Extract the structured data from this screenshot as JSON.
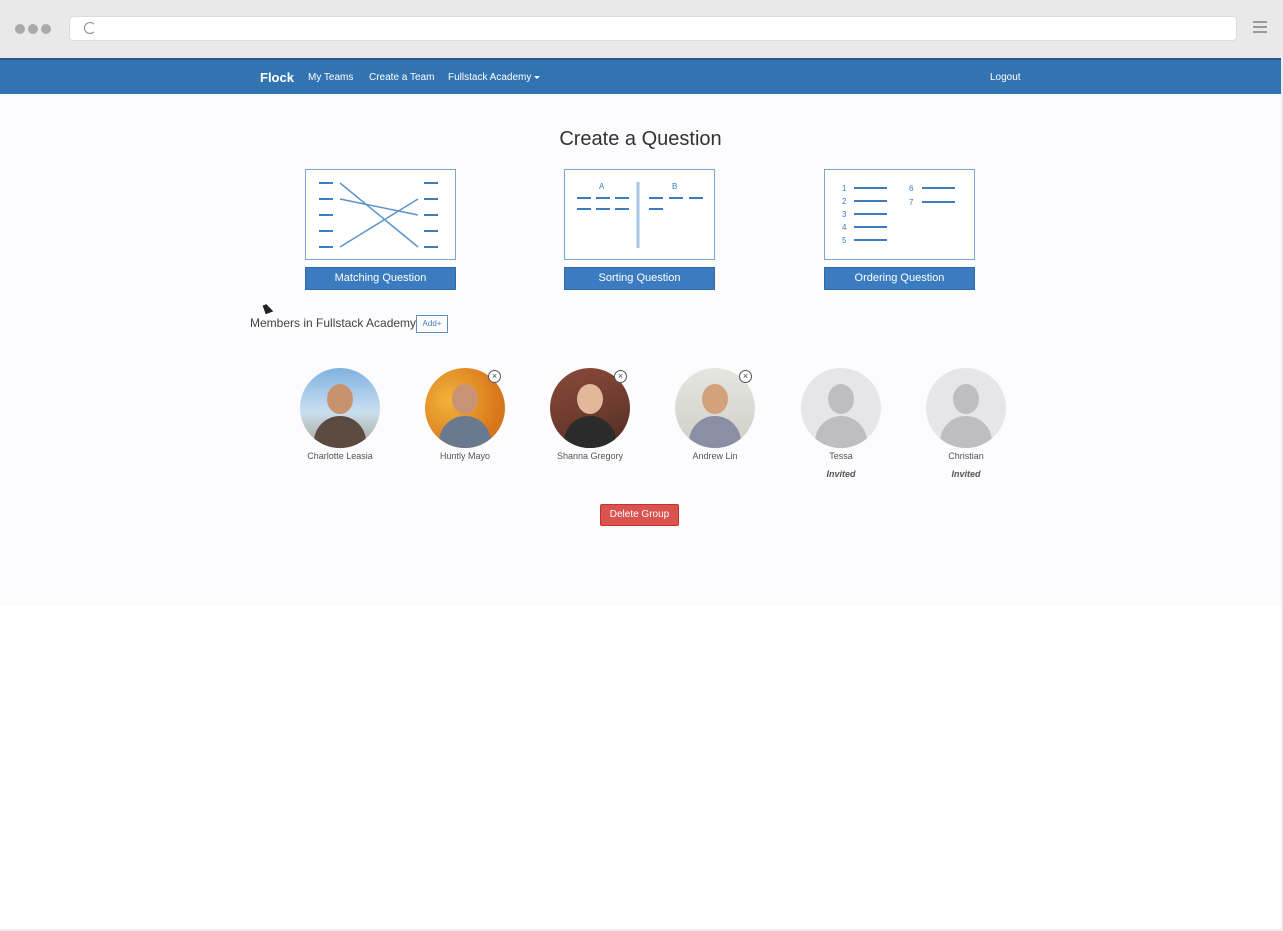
{
  "navbar": {
    "brand": "Flock",
    "links": [
      "My Teams",
      "Create a Team",
      "Fullstack Academy"
    ],
    "logout": "Logout"
  },
  "main": {
    "title": "Create a Question",
    "question_types": [
      {
        "label": "Matching Question",
        "icon": "matching-diagram"
      },
      {
        "label": "Sorting Question",
        "icon": "sorting-diagram",
        "col_a": "A",
        "col_b": "B"
      },
      {
        "label": "Ordering Question",
        "icon": "ordering-diagram",
        "numbers": [
          "1",
          "2",
          "3",
          "4",
          "5",
          "6",
          "7"
        ]
      }
    ],
    "members_label": "Members in Fullstack Academy",
    "add_label": "Add+",
    "members": [
      {
        "name": "Charlotte Leasia",
        "status": "",
        "removable": false
      },
      {
        "name": "Huntly Mayo",
        "status": "",
        "removable": true
      },
      {
        "name": "Shanna Gregory",
        "status": "",
        "removable": true
      },
      {
        "name": "Andrew Lin",
        "status": "",
        "removable": true
      },
      {
        "name": "Tessa",
        "status": "Invited",
        "removable": false
      },
      {
        "name": "Christian",
        "status": "Invited",
        "removable": false
      }
    ],
    "delete_label": "Delete Group"
  },
  "colors": {
    "primary": "#3274b2",
    "button": "#3b7cc0",
    "danger": "#d9534f"
  }
}
